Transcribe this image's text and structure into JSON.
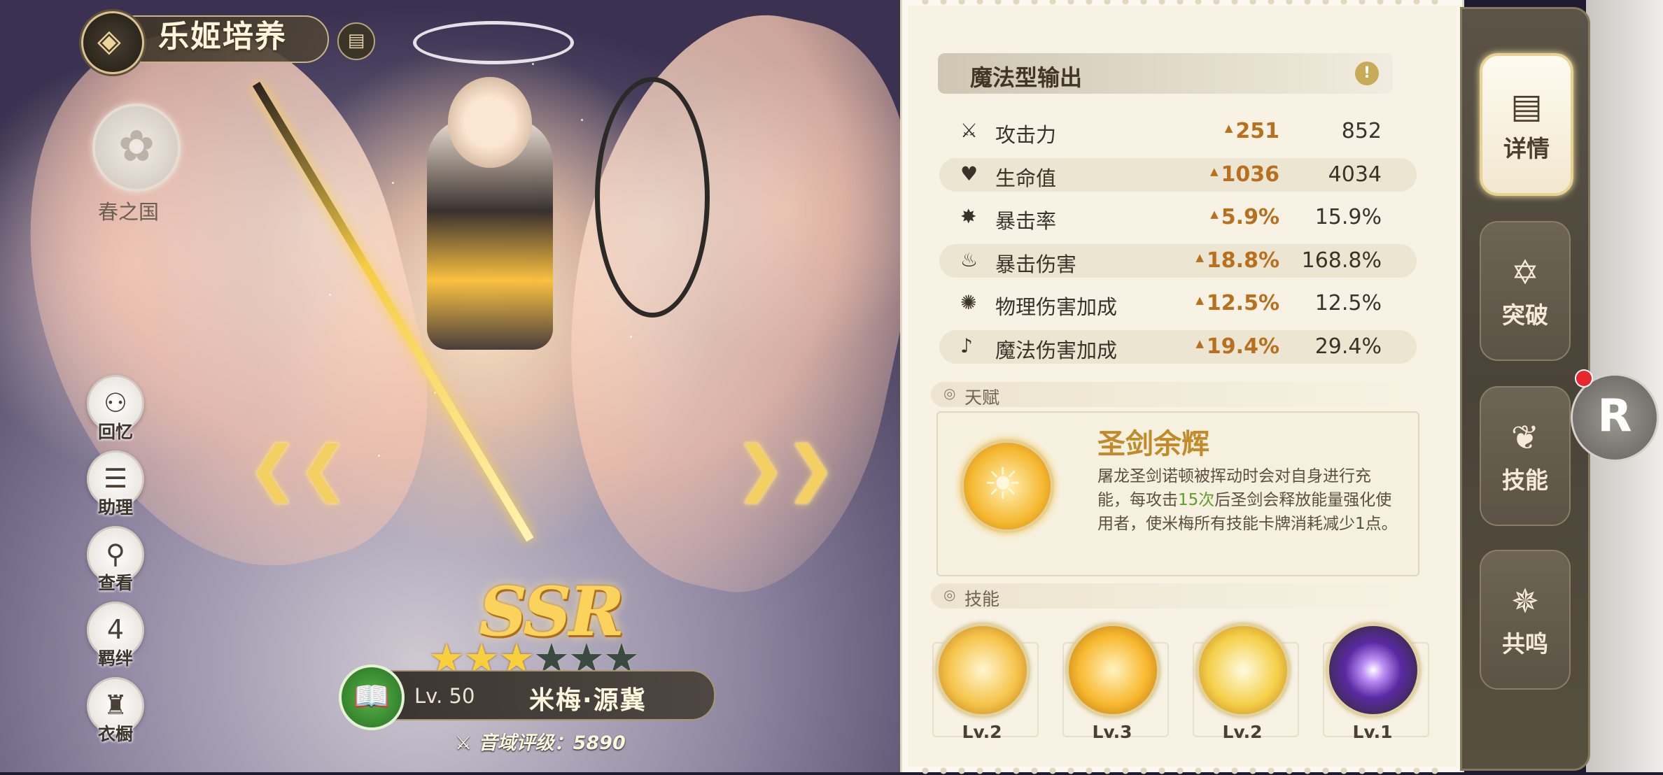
{
  "header": {
    "title": "乐姬培养",
    "back_icon": "diamond-back-icon",
    "doc_icon": "document-icon"
  },
  "faction": {
    "name": "春之国",
    "icon": "cherry-blossom-icon"
  },
  "left_menu": [
    {
      "label": "回忆",
      "icon": "memory-icon",
      "glyph": "⚇"
    },
    {
      "label": "助理",
      "icon": "assistant-icon",
      "glyph": "☰"
    },
    {
      "label": "查看",
      "icon": "magnifier-icon",
      "glyph": "⚲"
    },
    {
      "label": "羁绊",
      "icon": "heart-icon",
      "glyph": "4"
    },
    {
      "label": "衣橱",
      "icon": "wardrobe-icon",
      "glyph": "♜"
    }
  ],
  "character": {
    "rarity": "SSR",
    "stars_total": 6,
    "stars_filled": 3,
    "level": "Lv. 50",
    "name": "米梅·源冀",
    "rating": "音域评级：5890"
  },
  "role": {
    "type": "魔法型输出",
    "info_icon": "!"
  },
  "stats": [
    {
      "name": "攻击力",
      "icon": "sword-icon",
      "glyph": "⚔",
      "bonus": "251",
      "value": "852"
    },
    {
      "name": "生命值",
      "icon": "heart-icon",
      "glyph": "♥",
      "bonus": "1036",
      "value": "4034"
    },
    {
      "name": "暴击率",
      "icon": "burst-icon",
      "glyph": "✸",
      "bonus": "5.9%",
      "value": "15.9%"
    },
    {
      "name": "暴击伤害",
      "icon": "crit-damage-icon",
      "glyph": "♨",
      "bonus": "18.8%",
      "value": "168.8%"
    },
    {
      "name": "物理伤害加成",
      "icon": "physical-icon",
      "glyph": "✺",
      "bonus": "12.5%",
      "value": "12.5%"
    },
    {
      "name": "魔法伤害加成",
      "icon": "magic-icon",
      "glyph": "♪",
      "bonus": "19.4%",
      "value": "29.4%"
    }
  ],
  "talent": {
    "section_label": "天赋",
    "name": "圣剑余辉",
    "desc_before": "屠龙圣剑诺顿被挥动时会对自身进行充能，每攻击",
    "desc_highlight": "15次",
    "desc_after": "后圣剑会释放能量强化使用者，使米梅所有技能卡牌消耗减少1点。"
  },
  "skills": {
    "section_label": "技能",
    "items": [
      {
        "level": "Lv.2",
        "icon": "skill-1-icon"
      },
      {
        "level": "Lv.3",
        "icon": "skill-2-icon"
      },
      {
        "level": "Lv.2",
        "icon": "skill-3-icon"
      },
      {
        "level": "Lv.1",
        "icon": "skill-4-icon"
      }
    ]
  },
  "right_nav": [
    {
      "label": "详情",
      "icon": "detail-icon",
      "glyph": "▤",
      "active": true
    },
    {
      "label": "突破",
      "icon": "breakthrough-icon",
      "glyph": "✡",
      "active": false
    },
    {
      "label": "技能",
      "icon": "skill-tab-icon",
      "glyph": "❦",
      "active": false
    },
    {
      "label": "共鸣",
      "icon": "resonance-icon",
      "glyph": "✵",
      "active": false
    }
  ],
  "r_button": {
    "label": "R"
  },
  "colors": {
    "bonus": "#b8701e",
    "highlight": "#5d9e2a",
    "star_on": "#f9cf3d",
    "panel": "#f7f2e3"
  }
}
